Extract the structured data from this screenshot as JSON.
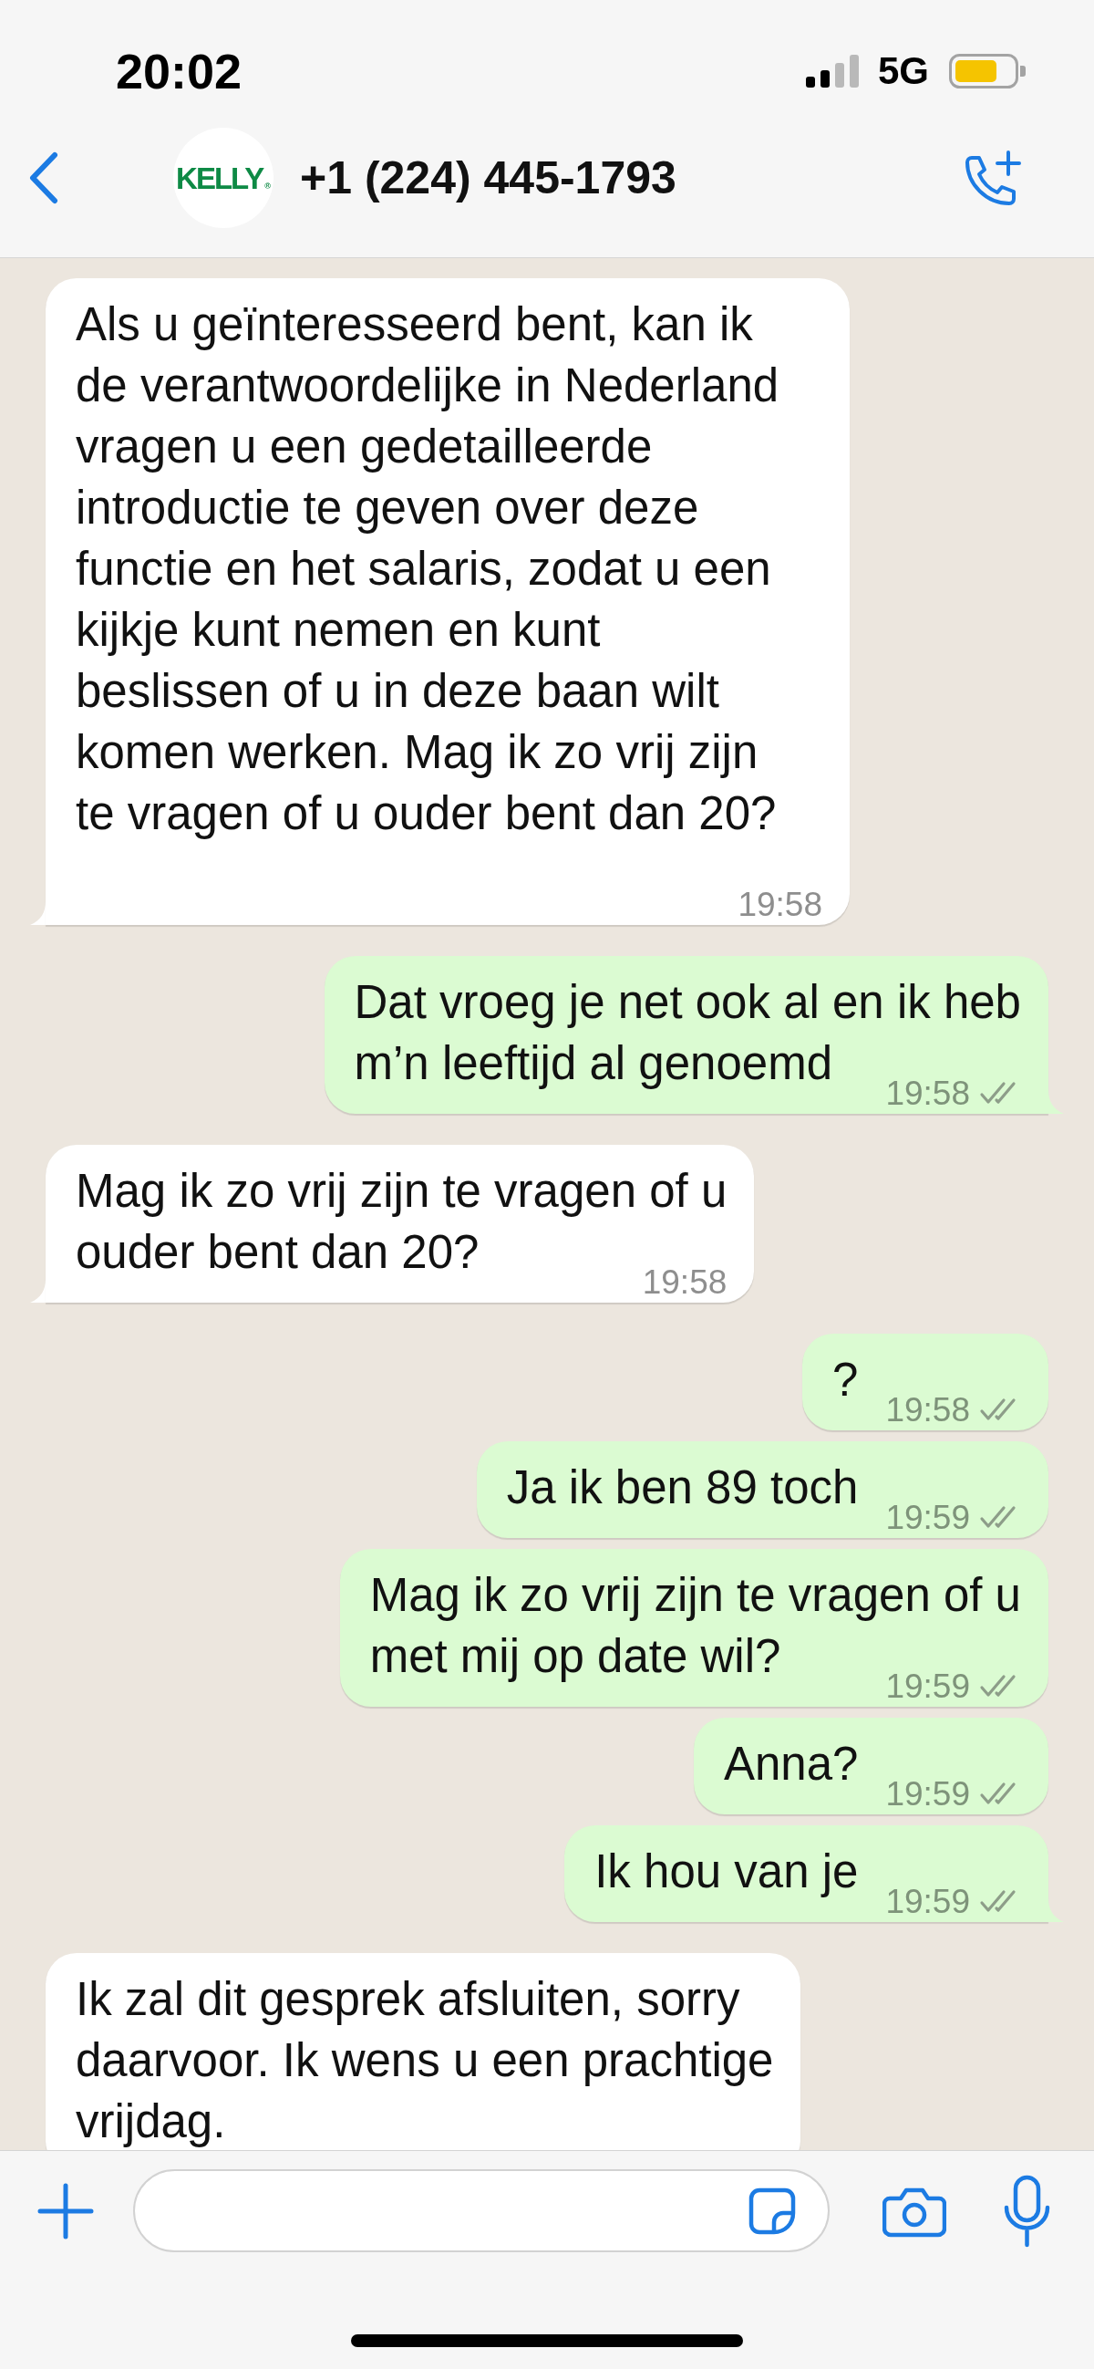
{
  "status_bar": {
    "time": "20:02",
    "network": "5G"
  },
  "header": {
    "avatar_logo": "KELLY$_{®}$",
    "title": "+1 (224) 445-1793"
  },
  "messages": [
    {
      "kind": "incoming",
      "text": "Als u geïnteresseerd bent, kan ik\nde verantwoordelijke in Nederland\nvragen u een gedetailleerde\nintroductie te geven over deze\nfunctie en het salaris, zodat u een\nkijkje kunt nemen en kunt\nbeslissen of u in deze baan wilt\nkomen werken. Mag ik zo vrij zijn\nte vragen of u ouder bent dan 20?",
      "time": "19:58",
      "tail": true
    },
    {
      "kind": "outgoing",
      "text": "Dat vroeg je net ook al en ik heb\nm’n leeftijd al genoemd",
      "time": "19:58",
      "read": false,
      "tail": true
    },
    {
      "kind": "incoming",
      "text": "Mag ik zo vrij zijn te vragen of u\nouder bent dan 20?",
      "time": "19:58",
      "tail": true
    },
    {
      "kind": "outgoing",
      "text": "?",
      "time": "19:58",
      "read": false,
      "tail": false
    },
    {
      "kind": "outgoing",
      "text": "Ja ik ben 89 toch",
      "time": "19:59",
      "read": false,
      "tail": false
    },
    {
      "kind": "outgoing",
      "text": "Mag ik zo vrij zijn te vragen of u\nmet mij op date wil?",
      "time": "19:59",
      "read": false,
      "tail": false
    },
    {
      "kind": "outgoing",
      "text": "Anna?",
      "time": "19:59",
      "read": false,
      "tail": false
    },
    {
      "kind": "outgoing",
      "text": "Ik hou van je",
      "time": "19:59",
      "read": false,
      "tail": true
    },
    {
      "kind": "incoming",
      "text": "Ik zal dit gesprek afsluiten, sorry\ndaarvoor. Ik wens u een prachtige\nvrijdag.",
      "tail": false
    }
  ]
}
